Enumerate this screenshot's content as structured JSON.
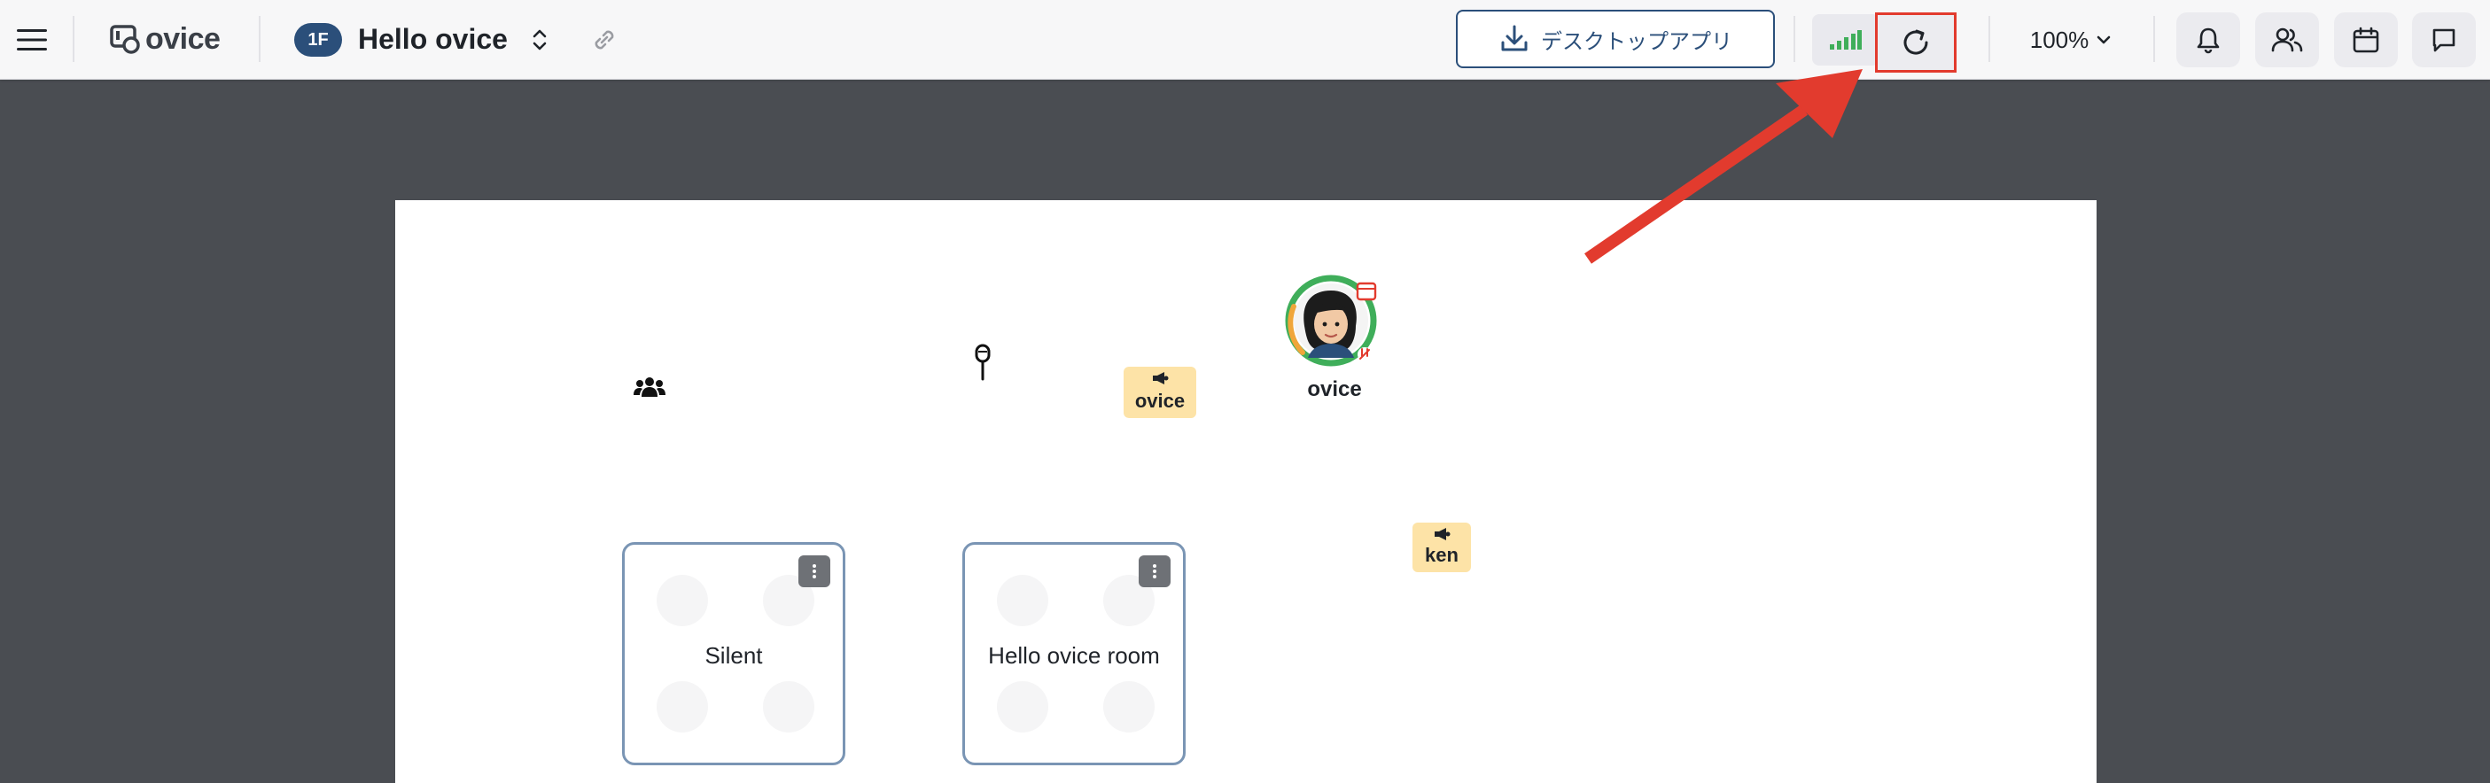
{
  "header": {
    "logo_text": "ovice",
    "floor_badge": "1F",
    "space_name": "Hello ovice",
    "desktop_app_label": "デスクトップアプリ",
    "zoom_value": "100%"
  },
  "icons": {
    "menu": "hamburger-icon",
    "space_switch": "chevron-up-down-icon",
    "link": "link-icon",
    "download": "download-icon",
    "signal": "signal-strength-icon",
    "reload": "reload-icon",
    "zoom_dropdown": "chevron-down-icon",
    "notifications": "bell-icon",
    "members": "users-icon",
    "calendar": "calendar-icon",
    "chat": "chat-icon"
  },
  "canvas": {
    "participants": [
      {
        "name": "ovice"
      }
    ],
    "speaker_tags": [
      {
        "label": "ovice"
      },
      {
        "label": "ken"
      }
    ],
    "rooms": [
      {
        "label": "Silent"
      },
      {
        "label": "Hello ovice room"
      }
    ]
  },
  "colors": {
    "brand_navy": "#2b4f7a",
    "highlight_red": "#e23b2e",
    "signal_green": "#3fae5a",
    "tag_yellow": "#fde3a7",
    "canvas_background": "#4a4d52"
  }
}
